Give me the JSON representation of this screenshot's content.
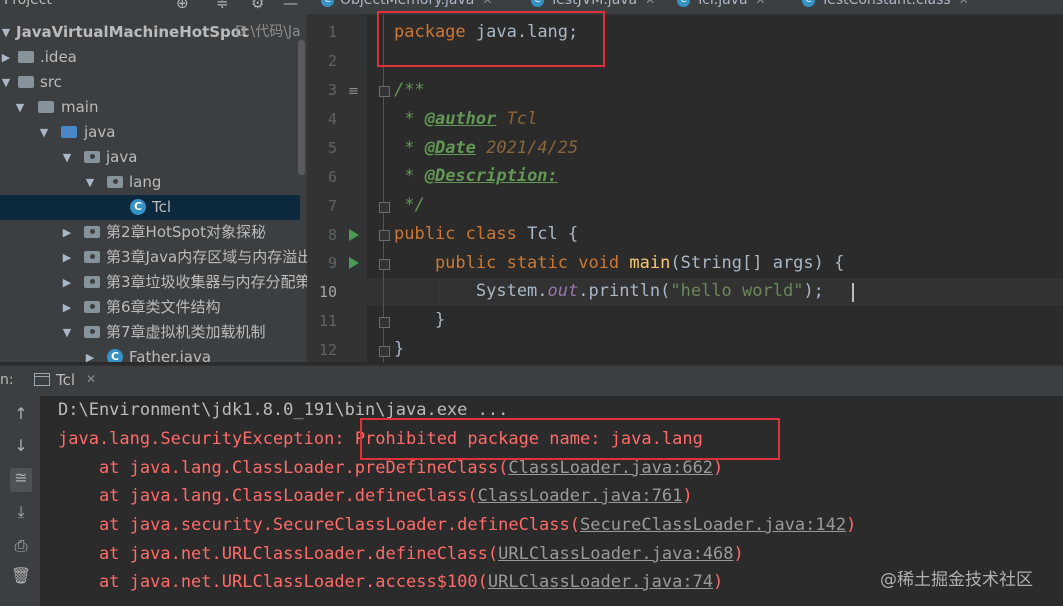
{
  "project_panel": {
    "title": "Project",
    "root": {
      "name": "JavaVirtualMachineHotSpot",
      "path": "D:\\代码\\Ja"
    },
    "items": [
      {
        "label": ".idea"
      },
      {
        "label": "src"
      },
      {
        "label": "main"
      },
      {
        "label": "java"
      },
      {
        "label": "java"
      },
      {
        "label": "lang"
      },
      {
        "label": "Tcl"
      },
      {
        "label": "第2章HotSpot对象探秘"
      },
      {
        "label": "第3章Java内存区域与内存溢出"
      },
      {
        "label": "第3章垃圾收集器与内存分配策"
      },
      {
        "label": "第6章类文件结构"
      },
      {
        "label": "第7章虚拟机类加载机制"
      },
      {
        "label": "Father.java"
      }
    ]
  },
  "editor_tabs": [
    {
      "label": "ObjectMemory.java"
    },
    {
      "label": "TestJVM.java"
    },
    {
      "label": "Tcl.java",
      "active": true
    },
    {
      "label": "TestConstant.class"
    }
  ],
  "editor": {
    "line_numbers": [
      "1",
      "2",
      "3",
      "4",
      "5",
      "6",
      "7",
      "8",
      "9",
      "10",
      "11",
      "12"
    ],
    "current_line": "10",
    "lines": {
      "l1_kw": "package",
      "l1_pkg": "java.lang;",
      "l3": "/**",
      "l4_star": " * ",
      "l4_tag": "@author",
      "l4_val": " Tcl",
      "l5_star": " * ",
      "l5_tag": "@Date",
      "l5_val": " 2021/4/25",
      "l6_star": " * ",
      "l6_tag": "@Description:",
      "l7": " */",
      "l8_kw": "public class",
      "l8_name": " Tcl {",
      "l9_kw": "    public static void",
      "l9_fn": " main",
      "l9_rest": "(String[] args) {",
      "l10_sys": "        System.",
      "l10_out": "out",
      "l10_call": ".println(",
      "l10_str": "\"hello world\"",
      "l10_end": ");",
      "l11": "    }",
      "l12": "}"
    }
  },
  "run_panel": {
    "label": "n:",
    "tab_label": "Tcl",
    "command": "D:\\Environment\\jdk1.8.0_191\\bin\\java.exe ...",
    "exception_prefix": "java.lang.SecurityException:",
    "exception_message": " Prohibited package name: java.lang",
    "stack": [
      {
        "at": "    at java.lang.ClassLoader.preDefineClass(",
        "link": "ClassLoader.java:662",
        "end": ")"
      },
      {
        "at": "    at java.lang.ClassLoader.defineClass(",
        "link": "ClassLoader.java:761",
        "end": ")"
      },
      {
        "at": "    at java.security.SecureClassLoader.defineClass(",
        "link": "SecureClassLoader.java:142",
        "end": ")"
      },
      {
        "at": "    at java.net.URLClassLoader.defineClass(",
        "link": "URLClassLoader.java:468",
        "end": ")"
      },
      {
        "at": "    at java.net.URLClassLoader.access$100(",
        "link": "URLClassLoader.java:74",
        "end": ")"
      }
    ]
  },
  "watermark": "@稀土掘金技术社区",
  "colors": {
    "highlight_box": "#e0303a",
    "error_text": "#ff6b68",
    "keyword": "#cc7832"
  }
}
